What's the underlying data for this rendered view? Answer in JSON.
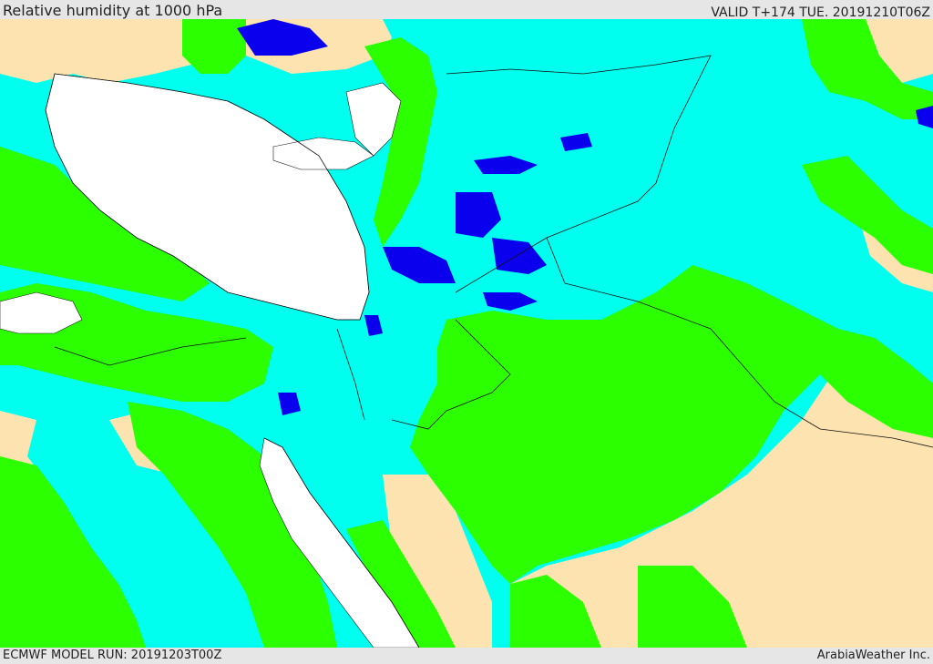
{
  "header": {
    "title": "Relative humidity at 1000 hPa",
    "valid_time": "VALID T+174 TUE. 20191210T06Z"
  },
  "footer": {
    "model_run": "ECMWF MODEL RUN: 20191203T00Z",
    "credit": "ArabiaWeather Inc."
  },
  "map": {
    "fill_colors": {
      "dry": "#fde3b0",
      "moist": "#2cff00",
      "humid": "#00ffee",
      "very_humid": "#0a00ee",
      "sea": "#ffffff"
    },
    "border_color": "#111111"
  }
}
